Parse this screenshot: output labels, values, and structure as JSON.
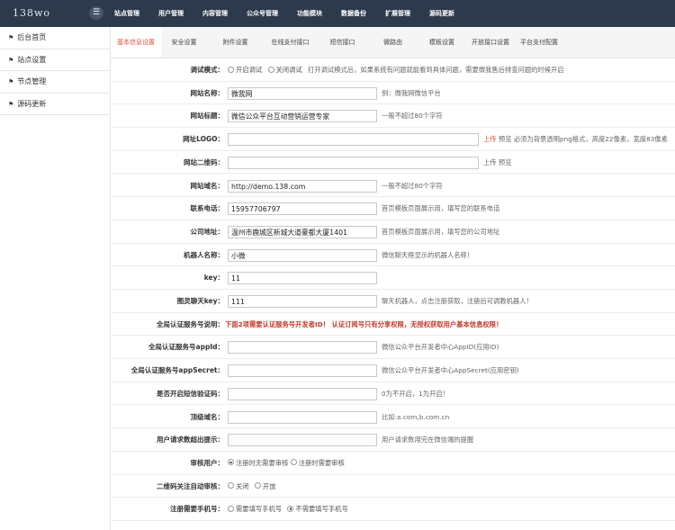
{
  "brand": "138wo",
  "menu_icon": "☰",
  "topnav": [
    "站点管理",
    "用户管理",
    "内容管理",
    "公众号管理",
    "功能模块",
    "数据备份",
    "扩展管理",
    "源码更新"
  ],
  "sidebar": [
    {
      "icon": "home-icon",
      "label": "后台首页"
    },
    {
      "icon": "site-icon",
      "label": "站点设置"
    },
    {
      "icon": "node-icon",
      "label": "节点管理"
    },
    {
      "icon": "update-icon",
      "label": "源码更新"
    }
  ],
  "tabs": [
    "基本信息设置",
    "安全设置",
    "附件设置",
    "在线支付接口",
    "短信接口",
    "微路由",
    "模板设置",
    "开放接口设置",
    "平台支付配置"
  ],
  "active_tab": 0,
  "form": {
    "debug": {
      "label": "调试模式：",
      "opt_on": "开启调试",
      "opt_off": "关闭调试",
      "tip": "打开调试模式后，如果系统有问题就能看到具体问题，需要微我售后排查问题的时候开启"
    },
    "site_name": {
      "label": "网站名称：",
      "value": "微我网",
      "tip": "例：微我网微信平台"
    },
    "site_title": {
      "label": "网站标题：",
      "value": "微信公众平台互动营销运营专家",
      "tip": "一般不超过80个字符"
    },
    "site_logo": {
      "label": "网址LOGO：",
      "value": "",
      "upload": "上传",
      "preview": "预览",
      "tip": "必须为背景透明png格式，高度22像素，宽度83像素"
    },
    "site_qrcode": {
      "label": "网站二维码：",
      "value": "",
      "upload": "上传",
      "preview": "预览"
    },
    "domain": {
      "label": "网站域名：",
      "value": "http://demo.138.com",
      "tip": "一般不超过80个字符"
    },
    "phone": {
      "label": "联系电话：",
      "value": "15957706797",
      "tip": "首页模板页面展示用，填写您的联系电话"
    },
    "address": {
      "label": "公司地址：",
      "value": "温州市鹿城区新城大道豪都大厦1401",
      "tip": "首页模板页面展示用，填写您的公司地址"
    },
    "robot_name": {
      "label": "机器人名称：",
      "value": "小微",
      "tip": "微信聊天框显示的机器人名称！"
    },
    "key": {
      "label": "key：",
      "value": "11"
    },
    "tuling_key": {
      "label": "图灵聊天key：",
      "value": "111",
      "tip": "聊天机器人，点击注册获取，注册后可调教机器人！"
    },
    "global_auth_desc": {
      "label": "全局认证服务号说明：",
      "text": "下面2项需要认证服务号开发者ID！ 认证订阅号只有分享权限，无授权获取用户基本信息权限！"
    },
    "app_id": {
      "label": "全局认证服务号appId：",
      "value": "",
      "tip": "微信公众平台开发者中心AppID(应用ID)"
    },
    "app_secret": {
      "label": "全局认证服务号appSecret：",
      "value": "",
      "tip": "微信公众平台开发者中心AppSecret(应用密钥)"
    },
    "sms_verify": {
      "label": "是否开启短信验证码：",
      "value": "",
      "tip": "0为不开启，1为开启！"
    },
    "top_domain": {
      "label": "顶级域名：",
      "value": "",
      "tip": "比如:a.com,b.com.cn"
    },
    "timeout_tip": {
      "label": "用户请求数超出提示：",
      "value": "",
      "tip": "用户请求数用完在微信端的提醒"
    },
    "review_user": {
      "label": "审核用户：",
      "opt_a": "注册时无需要审核",
      "opt_b": "注册时需要审核"
    },
    "qrcode_reg": {
      "label": "二维码关注自动审核：",
      "opt_a": "关闭",
      "opt_b": "开放"
    },
    "phone_reg": {
      "label": "注册需要手机号：",
      "opt_a": "需要填写手机号",
      "opt_b": "不需要填写手机号"
    }
  }
}
